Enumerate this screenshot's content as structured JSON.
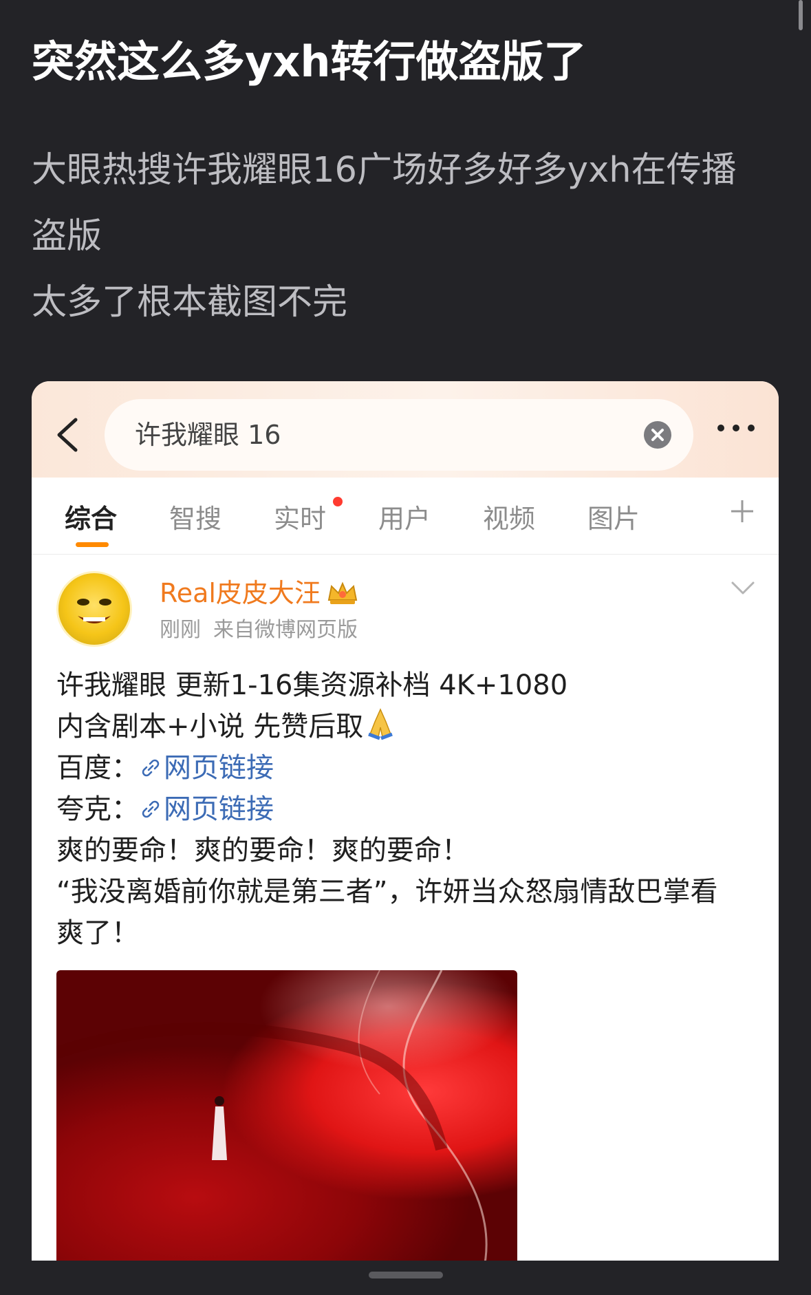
{
  "post": {
    "title": "突然这么多yxh转行做盗版了",
    "body_line1": "大眼热搜许我耀眼16广场好多好多yxh在传播",
    "body_line2": "盗版",
    "body_line3": "太多了根本截图不完"
  },
  "screenshot": {
    "search": {
      "query": "许我耀眼 16"
    },
    "tabs": [
      "综合",
      "智搜",
      "实时",
      "用户",
      "视频",
      "图片"
    ],
    "active_tab": "综合",
    "accent_color": "#ff8a00",
    "weibo": {
      "user_name": "Real皮皮大汪",
      "time": "刚刚",
      "source": "来自微博网页版",
      "line1": "许我耀眼 更新1-16集资源补档 4K+1080",
      "line2": "内含剧本+小说 先赞后取",
      "baidu_label": "百度：",
      "quark_label": "夸克：",
      "link_text": "网页链接",
      "line5": "爽的要命！爽的要命！爽的要命！",
      "line6": "“我没离婚前你就是第三者”，许妍当众怒扇情敌巴掌看",
      "line7": "爽了！"
    }
  }
}
